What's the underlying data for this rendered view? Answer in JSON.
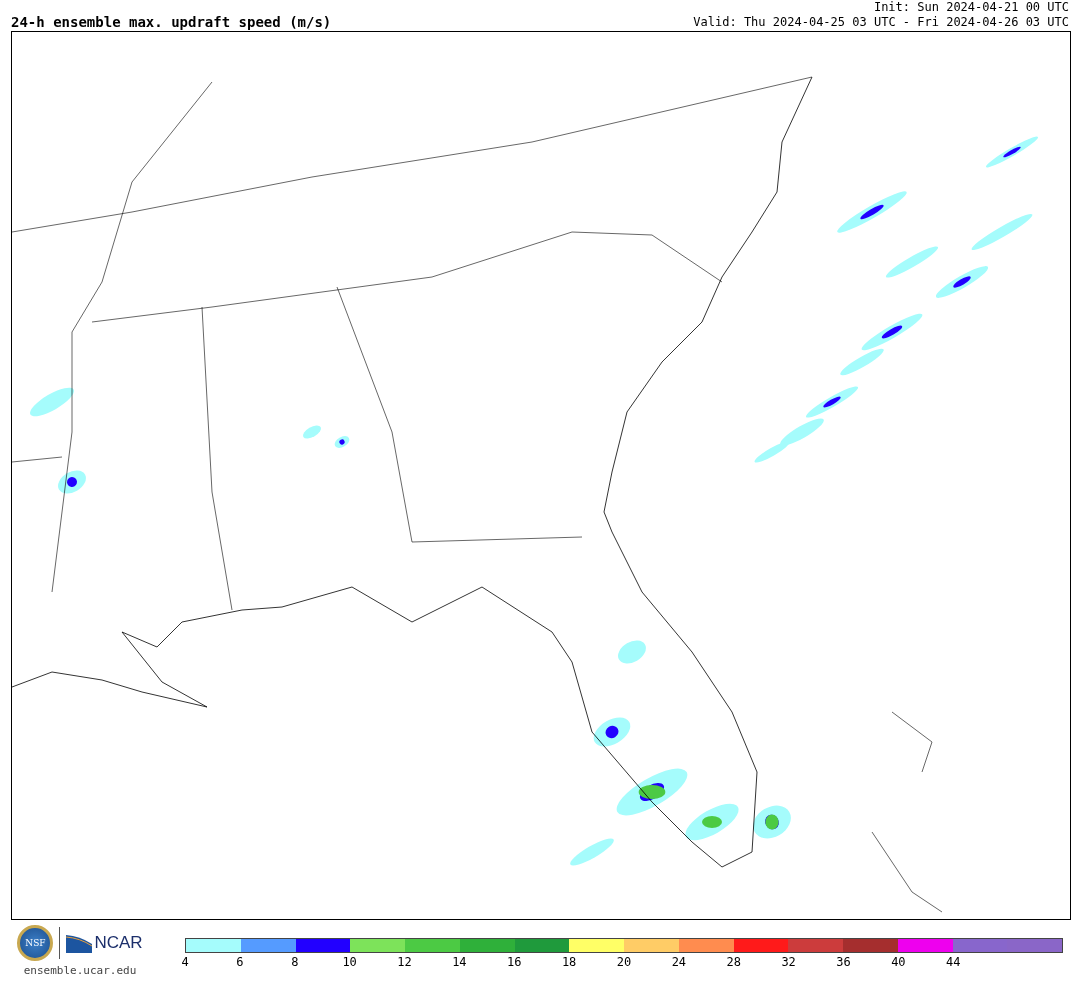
{
  "header": {
    "title": "24-h ensemble max. updraft speed (m/s)",
    "init": "Init: Sun 2024-04-21 00 UTC",
    "valid": "Valid: Thu 2024-04-25 03 UTC - Fri 2024-04-26 03 UTC"
  },
  "footer": {
    "seal_text": "NSF",
    "logo_text": "NCAR",
    "url": "ensemble.ucar.edu"
  },
  "colorbar": [
    {
      "color": "#a5fcfc",
      "tick": "4"
    },
    {
      "color": "#559bff",
      "tick": "6"
    },
    {
      "color": "#2200ff",
      "tick": "8"
    },
    {
      "color": "#7de35a",
      "tick": "10"
    },
    {
      "color": "#4cca44",
      "tick": "12"
    },
    {
      "color": "#2fb03a",
      "tick": "14"
    },
    {
      "color": "#1f9a3c",
      "tick": "16"
    },
    {
      "color": "#ffff66",
      "tick": "18"
    },
    {
      "color": "#ffcc66",
      "tick": "20"
    },
    {
      "color": "#ff8c4f",
      "tick": "24"
    },
    {
      "color": "#ff1a1a",
      "tick": "28"
    },
    {
      "color": "#cc3c3c",
      "tick": "32"
    },
    {
      "color": "#a52e2e",
      "tick": "36"
    },
    {
      "color": "#ee00ee",
      "tick": "40"
    },
    {
      "color": "#8866cc",
      "tick": "44"
    },
    {
      "color": "#8a66c8"
    }
  ]
}
